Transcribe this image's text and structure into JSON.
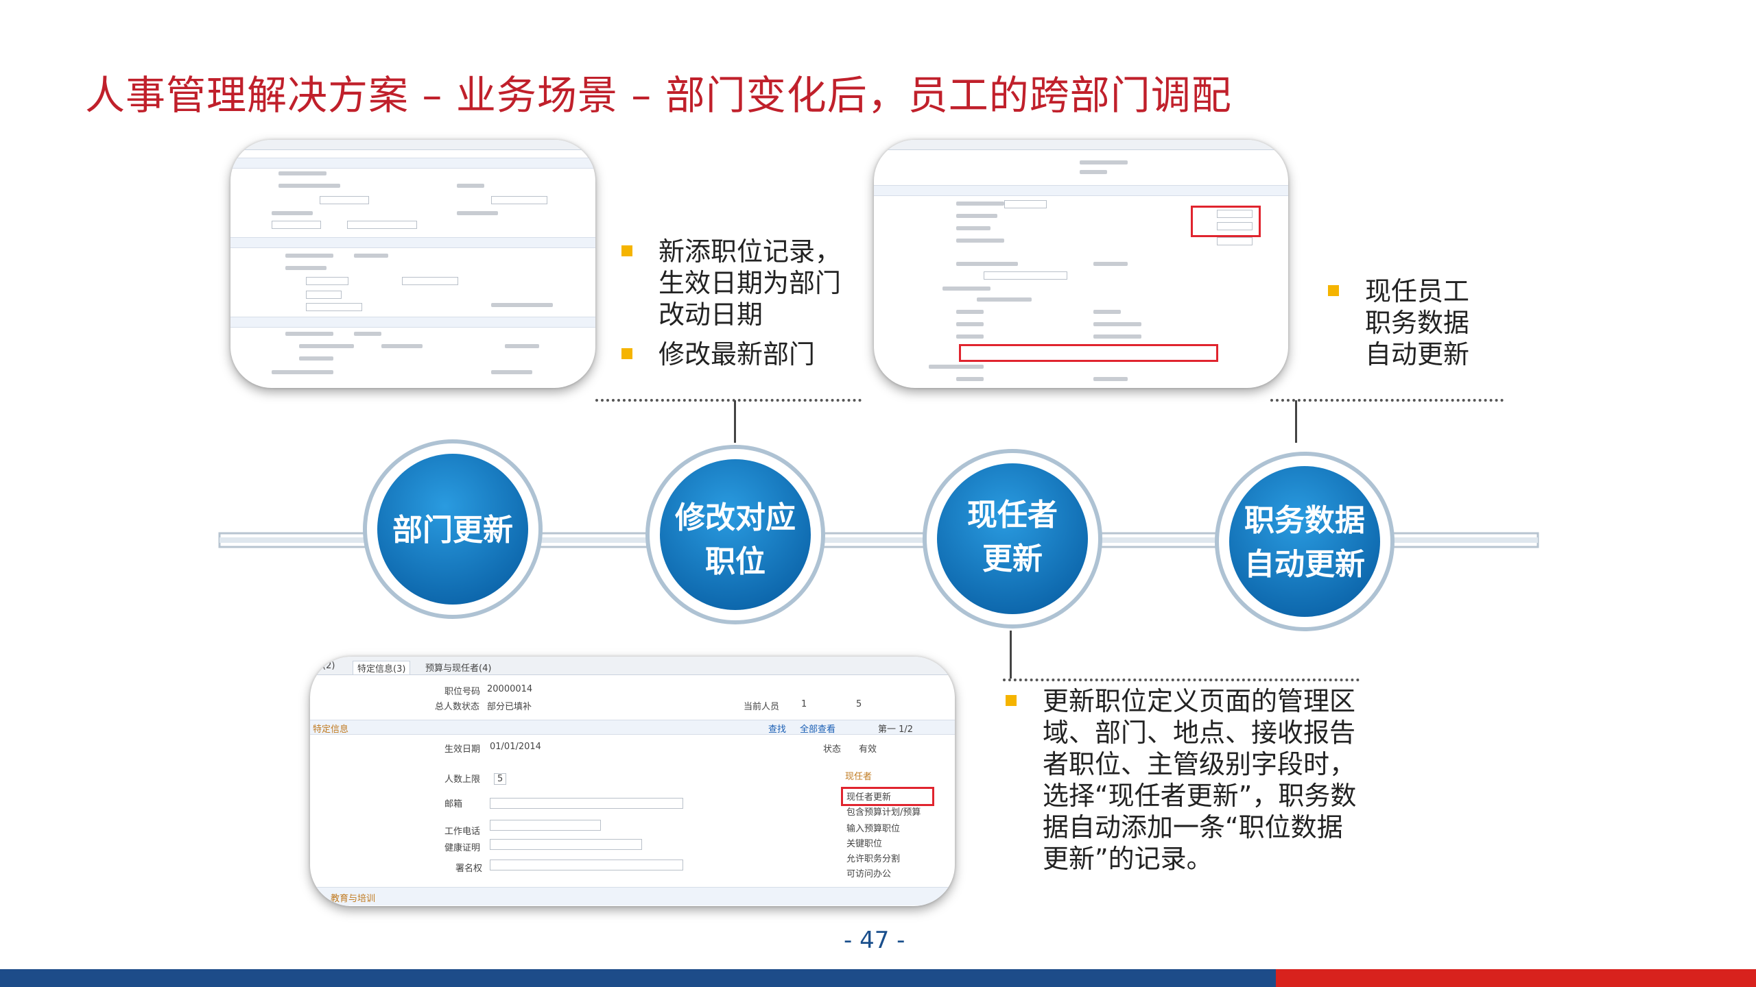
{
  "slide": {
    "title": "人事管理解决方案 – 业务场景 – 部门变化后，员工的跨部门调配",
    "page_number": "- 47 -"
  },
  "nodes": [
    {
      "lines": [
        "部门更新"
      ]
    },
    {
      "lines": [
        "修改对应",
        "职位"
      ]
    },
    {
      "lines": [
        "现任者",
        "更新"
      ]
    },
    {
      "lines": [
        "职务数据",
        "自动更新"
      ]
    }
  ],
  "notes": {
    "top_left": [
      "新添职位记录，生效日期为部门改动日期",
      "修改最新部门"
    ],
    "top_right": [
      "现任员工职务数据自动更新"
    ],
    "bottom": [
      "更新职位定义页面的管理区域、部门、地点、接收报告者职位、主管级别字段时，选择“现任者更新”，职务数据自动添加一条“职位数据更新”的记录。"
    ]
  },
  "screenshot_bottom": {
    "tabs": [
      "(2)",
      "特定信息(3)",
      "预算与现任者(4)"
    ],
    "position_no_label": "职位号码",
    "position_no_value": "20000014",
    "headcount_status_label": "总人数状态",
    "headcount_status_value": "部分已填补",
    "current_staff_label": "当前人员",
    "current_staff_value": "1",
    "current_staff_total": "5",
    "section_label": "特定信息",
    "links": [
      "查找",
      "全部查看"
    ],
    "pager": "第一 1/2",
    "effective_date_label": "生效日期",
    "effective_date_value": "01/01/2014",
    "status_label": "状态",
    "status_value": "有效",
    "max_headcount_label": "人数上限",
    "max_headcount_value": "5",
    "email_label": "邮箱",
    "phone_label": "工作电话",
    "health_cert_label": "健康证明",
    "signature_label": "署名权",
    "incumbent_group_label": "现任者",
    "checkbox_incumbent_update": "现任者更新",
    "checkbox_budget": "包含预算计划/预算",
    "checkbox_pool": "输入预算职位",
    "checkbox_key": "关键职位",
    "checkbox_share": "允许职务分割",
    "checkbox_confidential": "可访问办公",
    "bottom_section": "教育与培训"
  }
}
